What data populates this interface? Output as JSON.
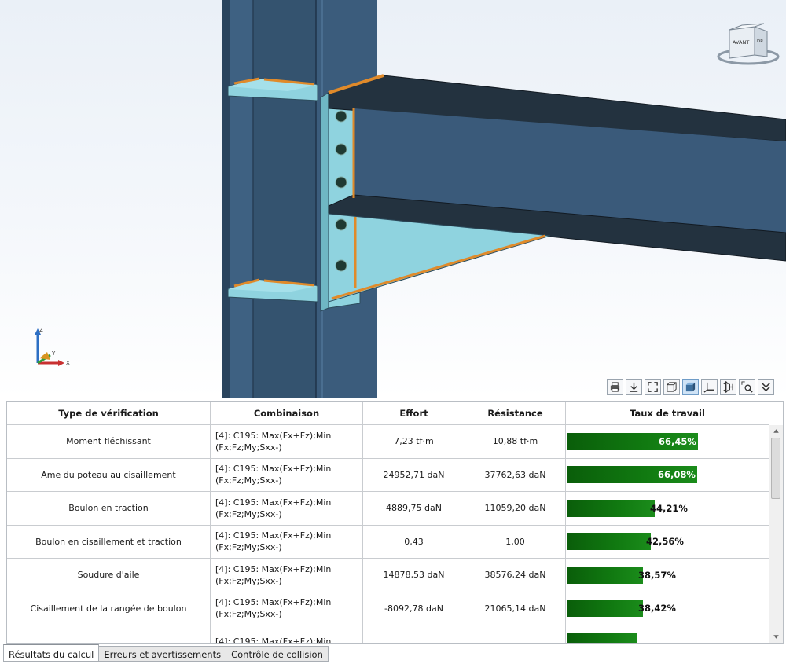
{
  "navcube": {
    "front_label": "AVANT",
    "side_label": "DR"
  },
  "axes": {
    "z": "Z",
    "y": "Y",
    "x": "X"
  },
  "toolbar": {
    "buttons": [
      {
        "name": "print-icon"
      },
      {
        "name": "export-icon"
      },
      {
        "name": "zoom-extents-icon"
      },
      {
        "name": "wireframe-view-icon"
      },
      {
        "name": "shaded-view-icon",
        "active": true
      },
      {
        "name": "axis-system-icon"
      },
      {
        "name": "height-dimension-icon"
      },
      {
        "name": "zoom-window-icon"
      },
      {
        "name": "chevron-down-icon"
      }
    ]
  },
  "table": {
    "headers": [
      "Type de vérification",
      "Combinaison",
      "Effort",
      "Résistance",
      "Taux de travail"
    ],
    "rows": [
      {
        "type": "Moment fléchissant",
        "combo": "[4]: C195: Max(Fx+Fz);Min (Fx;Fz;My;Sxx-)",
        "effort": "7,23 tf·m",
        "resistance": "10,88 tf·m",
        "ratio": "66,45%",
        "ratio_value": 0.6645
      },
      {
        "type": "Ame du poteau au cisaillement",
        "combo": "[4]: C195: Max(Fx+Fz);Min (Fx;Fz;My;Sxx-)",
        "effort": "24952,71 daN",
        "resistance": "37762,63 daN",
        "ratio": "66,08%",
        "ratio_value": 0.6608
      },
      {
        "type": "Boulon en traction",
        "combo": "[4]: C195: Max(Fx+Fz);Min (Fx;Fz;My;Sxx-)",
        "effort": "4889,75 daN",
        "resistance": "11059,20 daN",
        "ratio": "44,21%",
        "ratio_value": 0.4421
      },
      {
        "type": "Boulon en cisaillement et traction",
        "combo": "[4]: C195: Max(Fx+Fz);Min (Fx;Fz;My;Sxx-)",
        "effort": "0,43",
        "resistance": "1,00",
        "ratio": "42,56%",
        "ratio_value": 0.4256
      },
      {
        "type": "Soudure d'aile",
        "combo": "[4]: C195: Max(Fx+Fz);Min (Fx;Fz;My;Sxx-)",
        "effort": "14878,53 daN",
        "resistance": "38576,24 daN",
        "ratio": "38,57%",
        "ratio_value": 0.3857
      },
      {
        "type": "Cisaillement de la rangée de boulon",
        "combo": "[4]: C195: Max(Fx+Fz);Min (Fx;Fz;My;Sxx-)",
        "effort": "-8092,78 daN",
        "resistance": "21065,14 daN",
        "ratio": "38,42%",
        "ratio_value": 0.3842
      },
      {
        "type": "",
        "combo": "[4]: C195: Max(Fx+Fz);Min",
        "effort": "",
        "resistance": "",
        "ratio": "",
        "ratio_value": 0.35
      }
    ]
  },
  "tabs": [
    "Résultats du calcul",
    "Erreurs et avertissements",
    "Contrôle de collision"
  ],
  "colors": {
    "steel_dark": "#2f4a66",
    "steel_mid": "#3d5e80",
    "plate_cyan": "#8fd3df",
    "weld_orange": "#e08a2a",
    "bolt_dark": "#1f3a33",
    "bar_green": "#117a11"
  }
}
